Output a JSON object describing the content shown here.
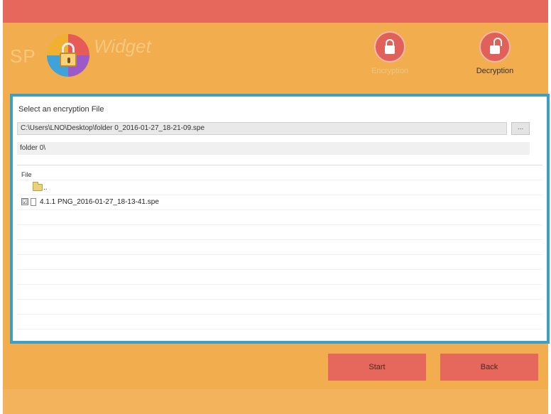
{
  "header": {
    "logo_sp": "SP",
    "logo_widget": "Widget",
    "encryption_label": "Encryption",
    "decryption_label": "Decryption"
  },
  "panel": {
    "select_label": "Select an encryption File",
    "path_value": "C:\\Users\\LNO\\Desktop\\folder 0_2016-01-27_18-21-09.spe",
    "browse_label": "...",
    "folder_label": "folder 0\\"
  },
  "file_list": {
    "column_header": "File",
    "up_label": "..",
    "files": [
      {
        "name": "4.1.1 PNG_2016-01-27_18-13-41.spe",
        "checked": "☑"
      }
    ]
  },
  "actions": {
    "start_label": "Start",
    "back_label": "Back"
  },
  "colors": {
    "title_bar": "#e6675b",
    "background": "#f2ad4e",
    "panel_border": "#3aa0c6",
    "button": "#e6675b"
  }
}
